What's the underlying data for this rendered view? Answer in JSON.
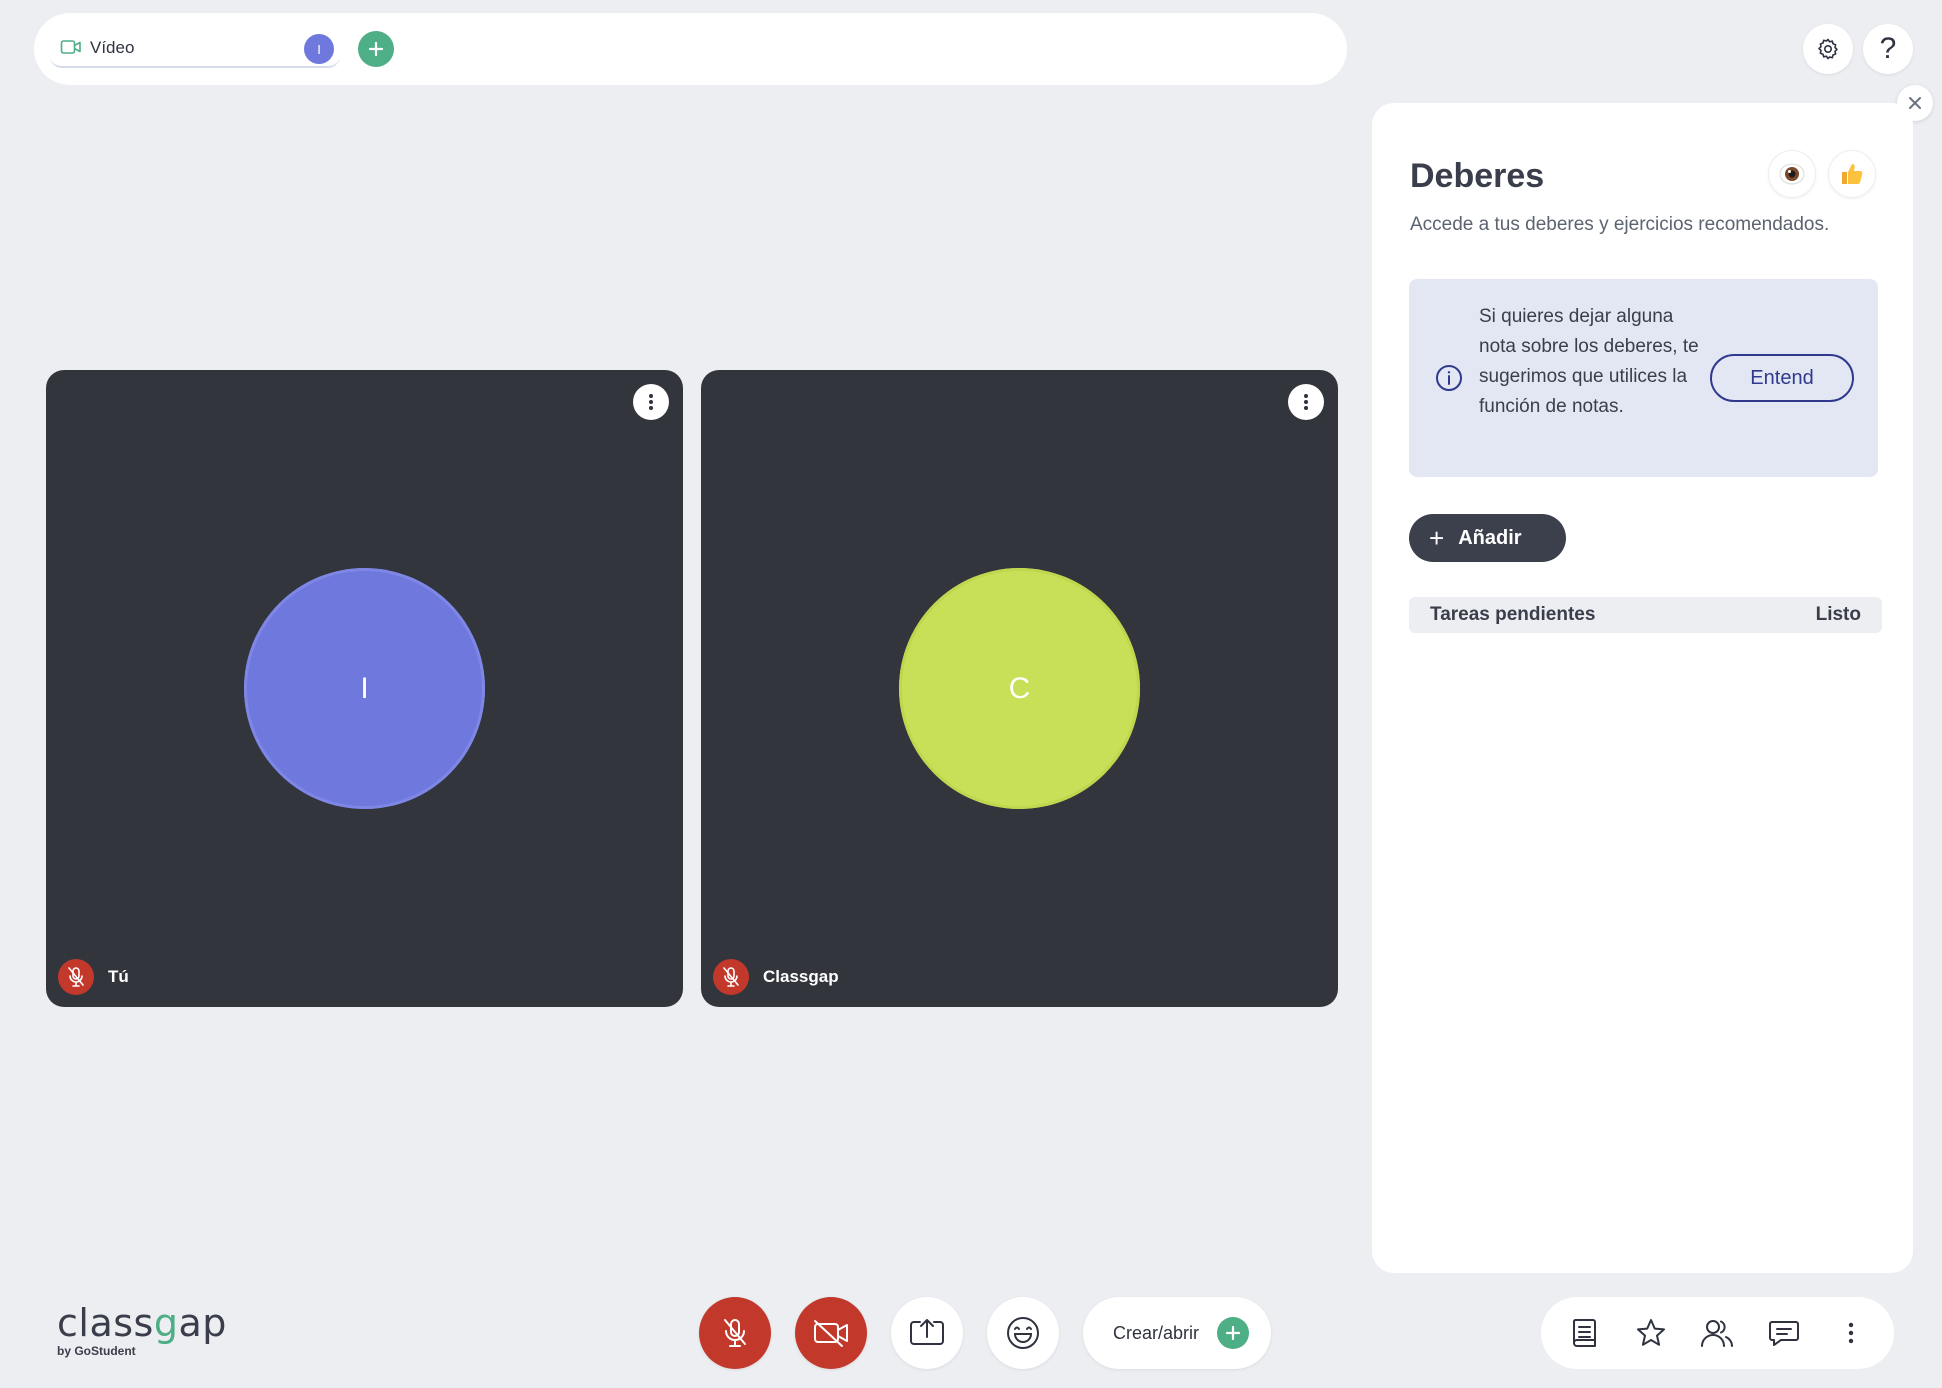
{
  "top_bar": {
    "tab": {
      "label": "Vídeo",
      "avatar_initial": "I",
      "icon": "video-camera-icon"
    },
    "add_tab_icon": "plus-icon"
  },
  "header_actions": {
    "settings_icon": "gear-icon",
    "help_label": "?"
  },
  "participants": [
    {
      "name": "Tú",
      "initial": "I",
      "color": "#6f78dc",
      "muted": true
    },
    {
      "name": "Classgap",
      "initial": "C",
      "color": "#c8e057",
      "muted": true
    }
  ],
  "homework_panel": {
    "title": "Deberes",
    "subtitle": "Accede a tus deberes y ejercicios recomendados.",
    "info": {
      "text": "Si quieres dejar alguna nota sobre los deberes, te sugerimos que utilices la función de notas.",
      "button_label": "Entend"
    },
    "add_button_label": "Añadir",
    "list_header": {
      "left": "Tareas pendientes",
      "right": "Listo"
    }
  },
  "logo": {
    "word": "classgap",
    "byline": "by GoStudent"
  },
  "controls": {
    "create_label": "Crear/abrir"
  },
  "colors": {
    "background": "#eceef2",
    "tile": "#33353d",
    "accent_green": "#4eae85",
    "mute_red": "#c2392b",
    "info_bg": "#e3e7f4",
    "link_blue": "#2f3a8f"
  }
}
